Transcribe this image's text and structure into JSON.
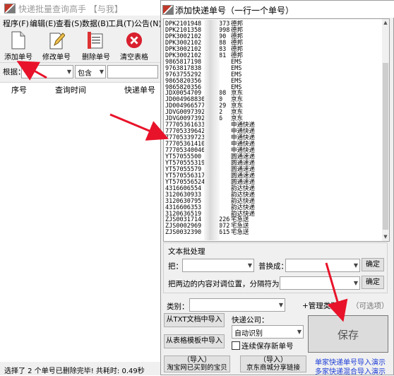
{
  "main_window": {
    "title": "快递批量查询高手  【与我】",
    "menu": [
      "程序(F)",
      "编辑(E)",
      "查看(S)",
      "数据(B)",
      "工具(T)",
      "公告(N)"
    ],
    "toolbar": [
      "添加单号",
      "修改单号",
      "删除单号",
      "清空表格"
    ],
    "filter": {
      "label": "根据：",
      "mode": "包含",
      "value": ""
    },
    "columns": [
      "序号",
      "查询时间",
      "快递单号"
    ],
    "status": "选择了 2 个单号已删除完毕! 共耗时: 0.49秒"
  },
  "dialog": {
    "title": "添加快递单号（一行一个单号）",
    "numbers": [
      {
        "no": "DPK2101948",
        "tail": "373",
        "carrier": "德邦"
      },
      {
        "no": "DPK2101358",
        "tail": "998",
        "carrier": "德邦"
      },
      {
        "no": "DPK3002102",
        "tail": "90",
        "carrier": "德邦"
      },
      {
        "no": "DPK3002102",
        "tail": "88",
        "carrier": "德邦"
      },
      {
        "no": "DPK3002102",
        "tail": "83",
        "carrier": "德邦"
      },
      {
        "no": "DPK3002102",
        "tail": "81",
        "carrier": "德邦"
      },
      {
        "no": "9865817198",
        "tail": "",
        "carrier": "EMS"
      },
      {
        "no": "9763817838",
        "tail": "",
        "carrier": "EMS"
      },
      {
        "no": "9763755292",
        "tail": "",
        "carrier": "EMS"
      },
      {
        "no": "9865820356",
        "tail": "",
        "carrier": "EMS"
      },
      {
        "no": "9865820356",
        "tail": "",
        "carrier": "EMS"
      },
      {
        "no": "JDX0054709",
        "tail": "08",
        "carrier": "京东"
      },
      {
        "no": "JD004968830",
        "tail": "0",
        "carrier": "京东"
      },
      {
        "no": "JD004966577",
        "tail": "29",
        "carrier": "京东"
      },
      {
        "no": "JDVG0097392",
        "tail": "2",
        "carrier": "京东"
      },
      {
        "no": "JDVG0097392",
        "tail": "6",
        "carrier": "京东"
      },
      {
        "no": "77705361633",
        "tail": "",
        "carrier": "申通快递"
      },
      {
        "no": "77705339642",
        "tail": "",
        "carrier": "申通快递"
      },
      {
        "no": "77705339723",
        "tail": "",
        "carrier": "申通快递"
      },
      {
        "no": "77705361410",
        "tail": "",
        "carrier": "申通快递"
      },
      {
        "no": "77705340046",
        "tail": "",
        "carrier": "申通快递"
      },
      {
        "no": "YT57055500",
        "tail": "",
        "carrier": "圆通速递"
      },
      {
        "no": "YT570555319",
        "tail": "",
        "carrier": "圆通速递"
      },
      {
        "no": "YT57055579",
        "tail": "",
        "carrier": "圆通速递"
      },
      {
        "no": "YT570556317",
        "tail": "",
        "carrier": "圆通速递"
      },
      {
        "no": "YT570556524",
        "tail": "",
        "carrier": "圆通速递"
      },
      {
        "no": "4316606554",
        "tail": "",
        "carrier": "韵达快递"
      },
      {
        "no": "3120630933",
        "tail": "",
        "carrier": "韵达快递"
      },
      {
        "no": "3120630795",
        "tail": "",
        "carrier": "韵达快递"
      },
      {
        "no": "4316606353",
        "tail": "",
        "carrier": "韵达快递"
      },
      {
        "no": "3120636519",
        "tail": "",
        "carrier": "韵达快递"
      },
      {
        "no": "ZJS0031714",
        "tail": "226",
        "carrier": "宅急送"
      },
      {
        "no": "ZJS0002969",
        "tail": "072",
        "carrier": "宅急送"
      },
      {
        "no": "ZJS0032390",
        "tail": "615",
        "carrier": "宅急送"
      }
    ],
    "replace_section_title": "文本批处理",
    "replace_from_label": "把：",
    "replace_to_label": "普换成：",
    "confirm_label": "确定",
    "swap_label": "把两边的内容对调位置，分隔符为：",
    "category_label": "类别：",
    "manage_category": "+管理类别",
    "optional_hint": "（可选项）",
    "import_txt": "从TXT文档中导入",
    "import_template": "从表格模板中导入",
    "courier_label": "快递公司：",
    "courier_value": "自动识别",
    "continuous_save": "连续保存新单号",
    "save_label": "保存",
    "import_taobao": "淘宝网已买到的宝贝",
    "import_jd": "京东商城分享链接",
    "taobao_title": "（导入）",
    "jd_title": "（导入）",
    "link1": "单家快递单号导入演示",
    "link2": "多家快递混合导入演示"
  },
  "colors": {
    "link": "#1a3bd6",
    "annotation_arrow": "#e8132a"
  }
}
